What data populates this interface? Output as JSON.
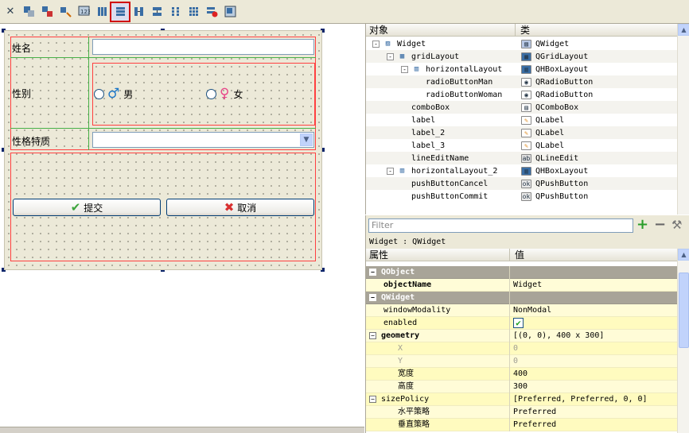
{
  "toolbar": {
    "items": [
      "close-icon",
      "edit-widgets-icon",
      "edit-signals-icon",
      "edit-buddies-icon",
      "edit-tab-order-icon",
      "layout-horizontal-icon",
      "layout-vertical-icon",
      "splitter-horizontal-icon",
      "splitter-vertical-icon",
      "layout-form-icon",
      "layout-grid-icon",
      "break-layout-icon",
      "adjust-size-icon"
    ],
    "active": "layout-vertical-icon"
  },
  "form": {
    "name_label": "姓名",
    "gender_label": "性别",
    "radio_male": "男",
    "radio_female": "女",
    "male_symbol": "♂",
    "female_symbol": "♀",
    "trait_label": "性格特质",
    "submit_label": "提交",
    "cancel_label": "取消",
    "submit_icon": "✔",
    "cancel_icon": "✖"
  },
  "object_inspector": {
    "col_object": "对象",
    "col_class": "类",
    "rows": [
      {
        "name": "Widget",
        "cls": "QWidget",
        "depth": 0,
        "exp": "-"
      },
      {
        "name": "gridLayout",
        "cls": "QGridLayout",
        "depth": 1,
        "exp": "-"
      },
      {
        "name": "horizontalLayout",
        "cls": "QHBoxLayout",
        "depth": 2,
        "exp": "-"
      },
      {
        "name": "radioButtonMan",
        "cls": "QRadioButton",
        "depth": 3,
        "exp": ""
      },
      {
        "name": "radioButtonWoman",
        "cls": "QRadioButton",
        "depth": 3,
        "exp": ""
      },
      {
        "name": "comboBox",
        "cls": "QComboBox",
        "depth": 2,
        "exp": ""
      },
      {
        "name": "label",
        "cls": "QLabel",
        "depth": 2,
        "exp": ""
      },
      {
        "name": "label_2",
        "cls": "QLabel",
        "depth": 2,
        "exp": ""
      },
      {
        "name": "label_3",
        "cls": "QLabel",
        "depth": 2,
        "exp": ""
      },
      {
        "name": "lineEditName",
        "cls": "QLineEdit",
        "depth": 2,
        "exp": ""
      },
      {
        "name": "horizontalLayout_2",
        "cls": "QHBoxLayout",
        "depth": 1,
        "exp": "-"
      },
      {
        "name": "pushButtonCancel",
        "cls": "QPushButton",
        "depth": 2,
        "exp": ""
      },
      {
        "name": "pushButtonCommit",
        "cls": "QPushButton",
        "depth": 2,
        "exp": ""
      }
    ]
  },
  "filter": {
    "placeholder": "Filter"
  },
  "property_editor": {
    "title": "Widget : QWidget",
    "col_property": "属性",
    "col_value": "值",
    "rows": [
      {
        "name": "QObject",
        "value": "",
        "kind": "section"
      },
      {
        "name": "objectName",
        "value": "Widget",
        "kind": "bold"
      },
      {
        "name": "QWidget",
        "value": "",
        "kind": "section"
      },
      {
        "name": "windowModality",
        "value": "NonModal",
        "kind": "normal"
      },
      {
        "name": "enabled",
        "value": "✔",
        "kind": "check"
      },
      {
        "name": "geometry",
        "value": "[(0, 0), 400 x 300]",
        "kind": "boldexp"
      },
      {
        "name": "X",
        "value": "0",
        "kind": "dis"
      },
      {
        "name": "Y",
        "value": "0",
        "kind": "dis"
      },
      {
        "name": "宽度",
        "value": "400",
        "kind": "sub"
      },
      {
        "name": "高度",
        "value": "300",
        "kind": "sub"
      },
      {
        "name": "sizePolicy",
        "value": "[Preferred, Preferred, 0, 0]",
        "kind": "exp"
      },
      {
        "name": "水平策略",
        "value": "Preferred",
        "kind": "sub"
      },
      {
        "name": "垂直策略",
        "value": "Preferred",
        "kind": "sub"
      }
    ]
  }
}
